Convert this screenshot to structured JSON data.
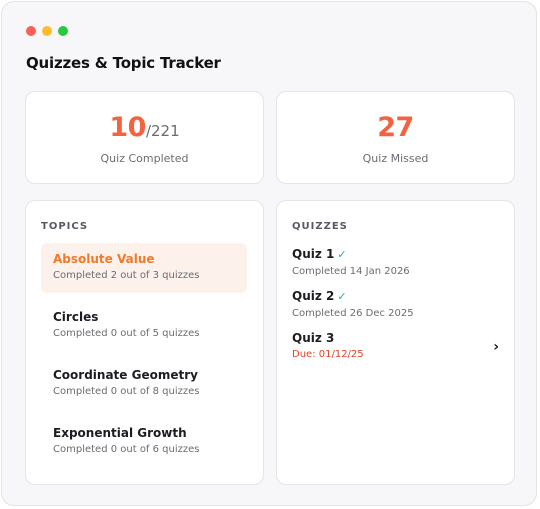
{
  "app": {
    "title": "Quizzes & Topic Tracker"
  },
  "stats": {
    "completed": {
      "value": "10",
      "total": "/221",
      "label": "Quiz Completed"
    },
    "missed": {
      "value": "27",
      "label": "Quiz Missed"
    }
  },
  "topics": {
    "heading": "TOPICS",
    "items": [
      {
        "name": "Absolute Value",
        "sub": "Completed 2 out of 3 quizzes"
      },
      {
        "name": "Circles",
        "sub": "Completed 0 out of 5 quizzes"
      },
      {
        "name": "Coordinate Geometry",
        "sub": "Completed 0 out of 8 quizzes"
      },
      {
        "name": "Exponential Growth",
        "sub": "Completed 0 out of 6 quizzes"
      }
    ]
  },
  "quizzes": {
    "heading": "QUIZZES",
    "check_mark": "✓",
    "chevron": "›",
    "items": [
      {
        "name": "Quiz 1",
        "sub": "Completed 14 Jan 2026"
      },
      {
        "name": "Quiz 2",
        "sub": "Completed 26 Dec 2025"
      },
      {
        "name": "Quiz 3",
        "sub": "Due: 01/12/25"
      }
    ]
  },
  "colors": {
    "accent": "#f2643f",
    "active_topic": "#f07a2c",
    "check": "#28b463",
    "due": "#e0452b"
  }
}
